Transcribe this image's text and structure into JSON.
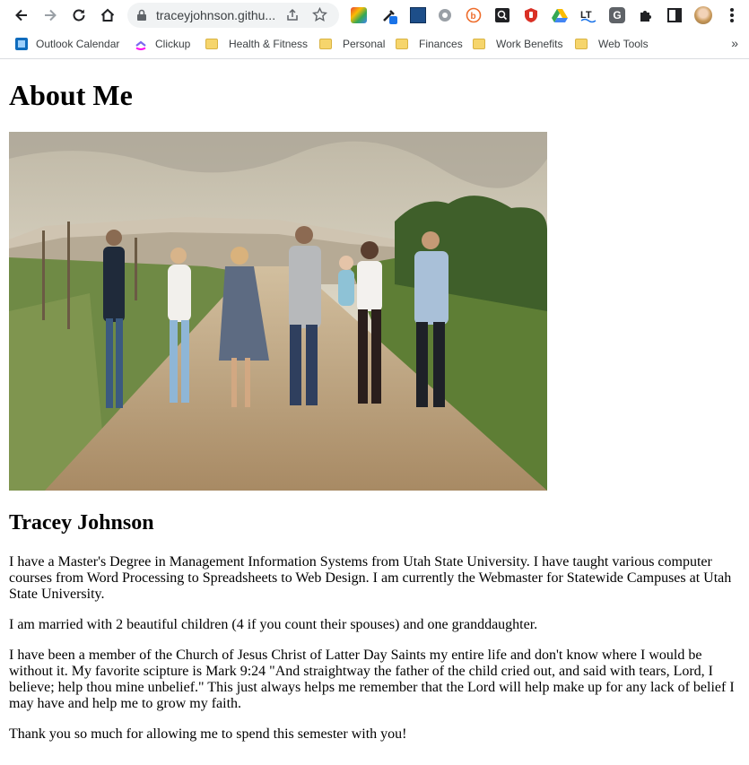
{
  "browser": {
    "url": "traceyjohnson.githu...",
    "bookmarks": [
      {
        "label": "Outlook Calendar",
        "icon": "outlook-icon"
      },
      {
        "label": "Clickup",
        "icon": "clickup-icon"
      },
      {
        "label": "Health & Fitness",
        "icon": "folder-icon"
      },
      {
        "label": "Personal",
        "icon": "folder-icon"
      },
      {
        "label": "Finances",
        "icon": "folder-icon"
      },
      {
        "label": "Work Benefits",
        "icon": "folder-icon"
      },
      {
        "label": "Web Tools",
        "icon": "folder-icon"
      }
    ],
    "more_label": "»"
  },
  "page": {
    "title": "About Me",
    "name": "Tracey Johnson",
    "paragraphs": [
      "I have a Master's Degree in Management Information Systems from Utah State University. I have taught various computer courses from Word Processing to Spreadsheets to Web Design. I am currently the Webmaster for Statewide Campuses at Utah State University.",
      "I am married with 2 beautiful children (4 if you count their spouses) and one granddaughter.",
      "I have been a member of the Church of Jesus Christ of Latter Day Saints my entire life and don't know where I would be without it. My favorite scipture is Mark 9:24 \"And straightway the father of the child cried out, and said with tears, Lord, I believe; help thou mine unbelief.\" This just always helps me remember that the Lord will help make up for any lack of belief I may have and help me to grow my faith.",
      "Thank you so much for allowing me to spend this semester with you!"
    ]
  }
}
